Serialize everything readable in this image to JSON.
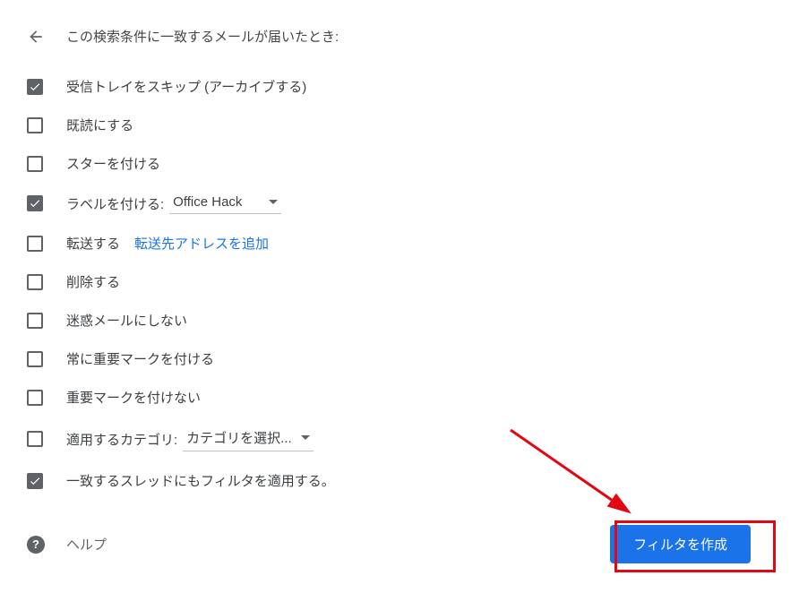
{
  "header": {
    "title": "この検索条件に一致するメールが届いたとき:"
  },
  "options": {
    "skip_inbox": {
      "label": "受信トレイをスキップ (アーカイブする)",
      "checked": true
    },
    "mark_read": {
      "label": "既読にする",
      "checked": false
    },
    "star": {
      "label": "スターを付ける",
      "checked": false
    },
    "apply_label": {
      "label": "ラベルを付ける:",
      "checked": true,
      "selected": "Office Hack"
    },
    "forward": {
      "label": "転送する",
      "checked": false,
      "link": "転送先アドレスを追加"
    },
    "delete": {
      "label": "削除する",
      "checked": false
    },
    "never_spam": {
      "label": "迷惑メールにしない",
      "checked": false
    },
    "always_important": {
      "label": "常に重要マークを付ける",
      "checked": false
    },
    "never_important": {
      "label": "重要マークを付けない",
      "checked": false
    },
    "category": {
      "label": "適用するカテゴリ:",
      "checked": false,
      "selected": "カテゴリを選択..."
    },
    "apply_existing": {
      "label": "一致するスレッドにもフィルタを適用する。",
      "checked": true
    }
  },
  "footer": {
    "help": "ヘルプ",
    "create_button": "フィルタを作成"
  }
}
